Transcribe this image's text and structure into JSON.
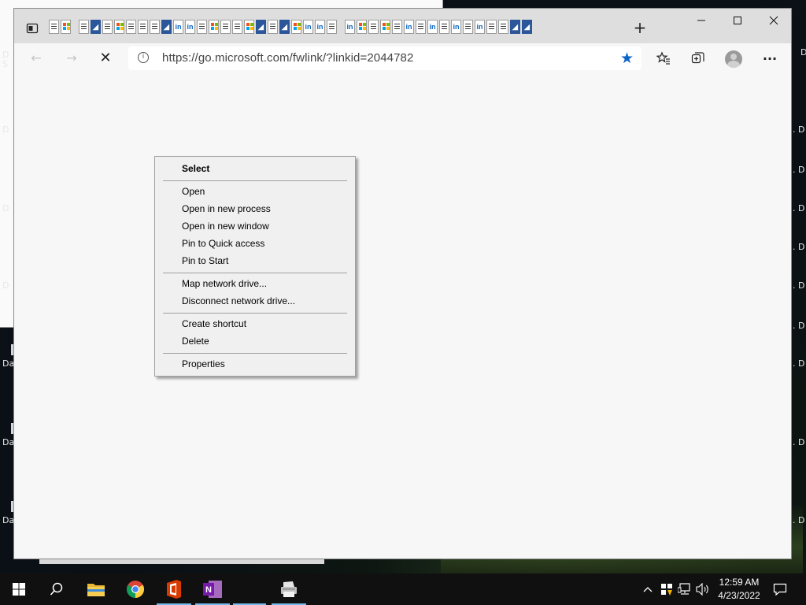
{
  "desktop": {
    "left_labels": [
      "D",
      "S",
      "D",
      "D",
      "D",
      "D",
      "Da",
      "Da",
      "Da"
    ],
    "right_labels": [
      "D",
      ". D",
      ". D",
      ". D",
      ". D",
      ". D",
      ". D",
      ". D",
      ". D",
      ". D"
    ]
  },
  "browser": {
    "favicon_tab_count": 42,
    "new_tab_label": "+",
    "window_controls": {
      "minimize": "—",
      "maximize": "☐",
      "close": "✕"
    },
    "toolbar": {
      "back": "←",
      "forward": "→",
      "stop": "✕",
      "url": "https://go.microsoft.com/fwlink/?linkid=2044782",
      "info_icon": "i",
      "favorite_star": "★",
      "more": "···"
    }
  },
  "context_menu": {
    "items": [
      {
        "label": "Select",
        "bold": true
      },
      {
        "label": "Open"
      },
      {
        "label": "Open in new process"
      },
      {
        "label": "Open in new window"
      },
      {
        "label": "Pin to Quick access"
      },
      {
        "label": "Pin to Start"
      },
      {
        "label": "Map network drive..."
      },
      {
        "label": "Disconnect network drive..."
      },
      {
        "label": "Create shortcut"
      },
      {
        "label": "Delete"
      },
      {
        "label": "Properties"
      }
    ]
  },
  "taskbar": {
    "apps": [
      "start",
      "search",
      "file-explorer",
      "chrome",
      "office",
      "onenote",
      "printer"
    ],
    "clock": {
      "time": "12:59 AM",
      "date": "4/23/2022"
    },
    "tray": {
      "chevron": "^",
      "volume": "🔊"
    }
  }
}
